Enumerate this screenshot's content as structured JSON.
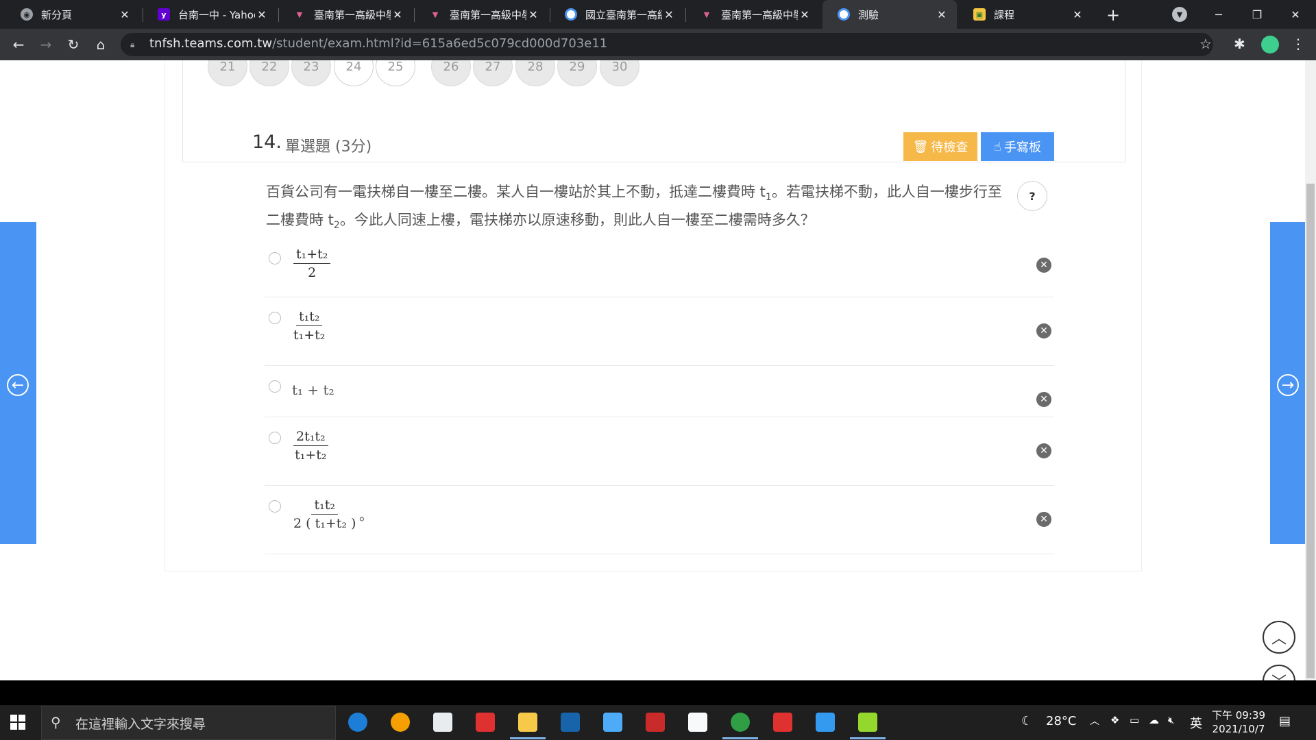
{
  "browser": {
    "tabs": [
      {
        "title": "新分頁",
        "favicon": "globe-icon",
        "color": "#9aa0a6"
      },
      {
        "title": "台南一中 - Yahoo",
        "favicon": "yahoo-icon",
        "color": "#6001d2"
      },
      {
        "title": "臺南第一高級中學",
        "favicon": "school-icon",
        "color": "#c2185b"
      },
      {
        "title": "臺南第一高級中學",
        "favicon": "school-icon",
        "color": "#c2185b"
      },
      {
        "title": "國立臺南第一高級",
        "favicon": "teams-icon",
        "color": "#4a94f4"
      },
      {
        "title": "臺南第一高級中學",
        "favicon": "school-icon",
        "color": "#c2185b"
      },
      {
        "title": "測驗",
        "favicon": "teams-icon",
        "color": "#4a94f4",
        "active": true
      },
      {
        "title": "課程",
        "favicon": "course-icon",
        "color": "#f4c542"
      }
    ],
    "url_host": "tnfsh.teams.com.tw",
    "url_path": "/student/exam.html?id=615a6ed5c079cd000d703e11"
  },
  "question_nav": {
    "numbers": [
      "21",
      "22",
      "23",
      "24",
      "25",
      "26",
      "27",
      "28",
      "29",
      "30"
    ]
  },
  "question": {
    "number": "14.",
    "type": "單選題 (3分)",
    "pending_label": "待檢查",
    "handwrite_label": "手寫板",
    "help_label": "?",
    "text_part1": "百貨公司有一電扶梯自一樓至二樓。某人自一樓站於其上不動，抵達二樓費時 t",
    "text_sub1": "1",
    "text_part2": "。若電扶梯不動，此人自一樓步行至二樓費時 t",
    "text_sub2": "2",
    "text_part3": "。今此人同速上樓，電扶梯亦以原速移動，則此人自一樓至二樓需時多久？",
    "options": [
      {
        "num": "t₁+t₂",
        "den": "2",
        "tail": ""
      },
      {
        "num": "t₁t₂",
        "den": "t₁+t₂",
        "tail": ""
      },
      {
        "inline": "t₁ + t₂"
      },
      {
        "num": "2t₁t₂",
        "den": "t₁+t₂",
        "tail": ""
      },
      {
        "num": "t₁t₂",
        "den": "2 ( t₁+t₂ )",
        "tail": "。"
      }
    ]
  },
  "taskbar": {
    "search_placeholder": "在這裡輸入文字來搜尋",
    "weather": "28°C",
    "ime": "英",
    "time": "下午 09:39",
    "date": "2021/10/7"
  },
  "colors": {
    "accent_blue": "#4a94f4",
    "pending_orange": "#f5b849"
  }
}
